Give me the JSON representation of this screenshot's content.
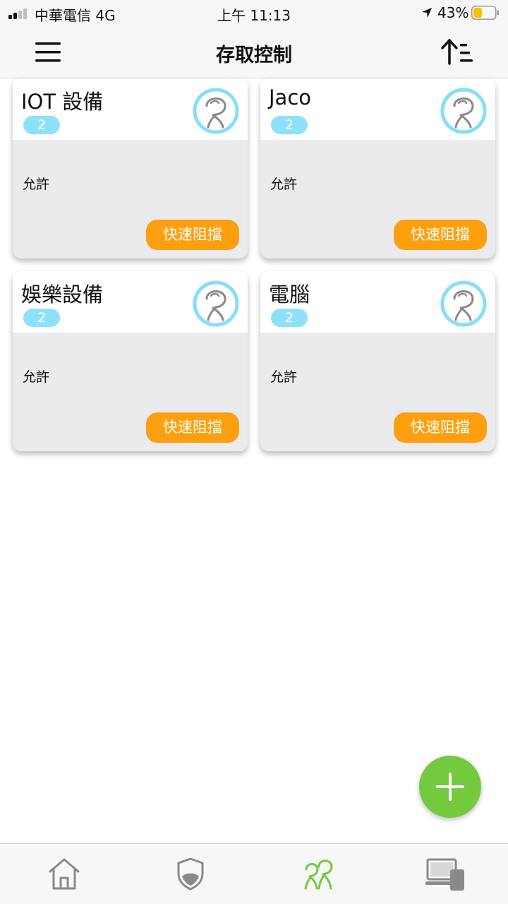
{
  "status_bar": {
    "carrier": "中華電信  4G",
    "time": "上午 11:13",
    "battery_percent": "43%",
    "battery_level": 0.43,
    "signal_bars": 2
  },
  "header": {
    "title": "存取控制",
    "menu_icon": "hamburger-icon",
    "sort_icon": "sort-ascending-icon"
  },
  "cards": [
    {
      "name": "IOT 設備",
      "count": "2",
      "status": "允許",
      "action": "快速阻擋",
      "avatar_icon": "profile-avatar-icon"
    },
    {
      "name": "Jaco",
      "count": "2",
      "status": "允許",
      "action": "快速阻擋",
      "avatar_icon": "profile-avatar-icon"
    },
    {
      "name": "娛樂設備",
      "count": "2",
      "status": "允許",
      "action": "快速阻擋",
      "avatar_icon": "profile-avatar-icon"
    },
    {
      "name": "電腦",
      "count": "2",
      "status": "允許",
      "action": "快速阻擋",
      "avatar_icon": "profile-avatar-icon"
    }
  ],
  "fab": {
    "icon": "plus-icon"
  },
  "tabs": [
    {
      "icon": "home-icon",
      "active": false
    },
    {
      "icon": "shield-icon",
      "active": false
    },
    {
      "icon": "profiles-icon",
      "active": true
    },
    {
      "icon": "devices-icon",
      "active": false
    }
  ],
  "colors": {
    "accent_green": "#74c93f",
    "block_orange": "#fd9f0e",
    "badge_blue": "#8fe1fa",
    "avatar_ring": "#86def8",
    "card_body": "#ebebee",
    "inactive_icon": "#8a8a8a"
  }
}
